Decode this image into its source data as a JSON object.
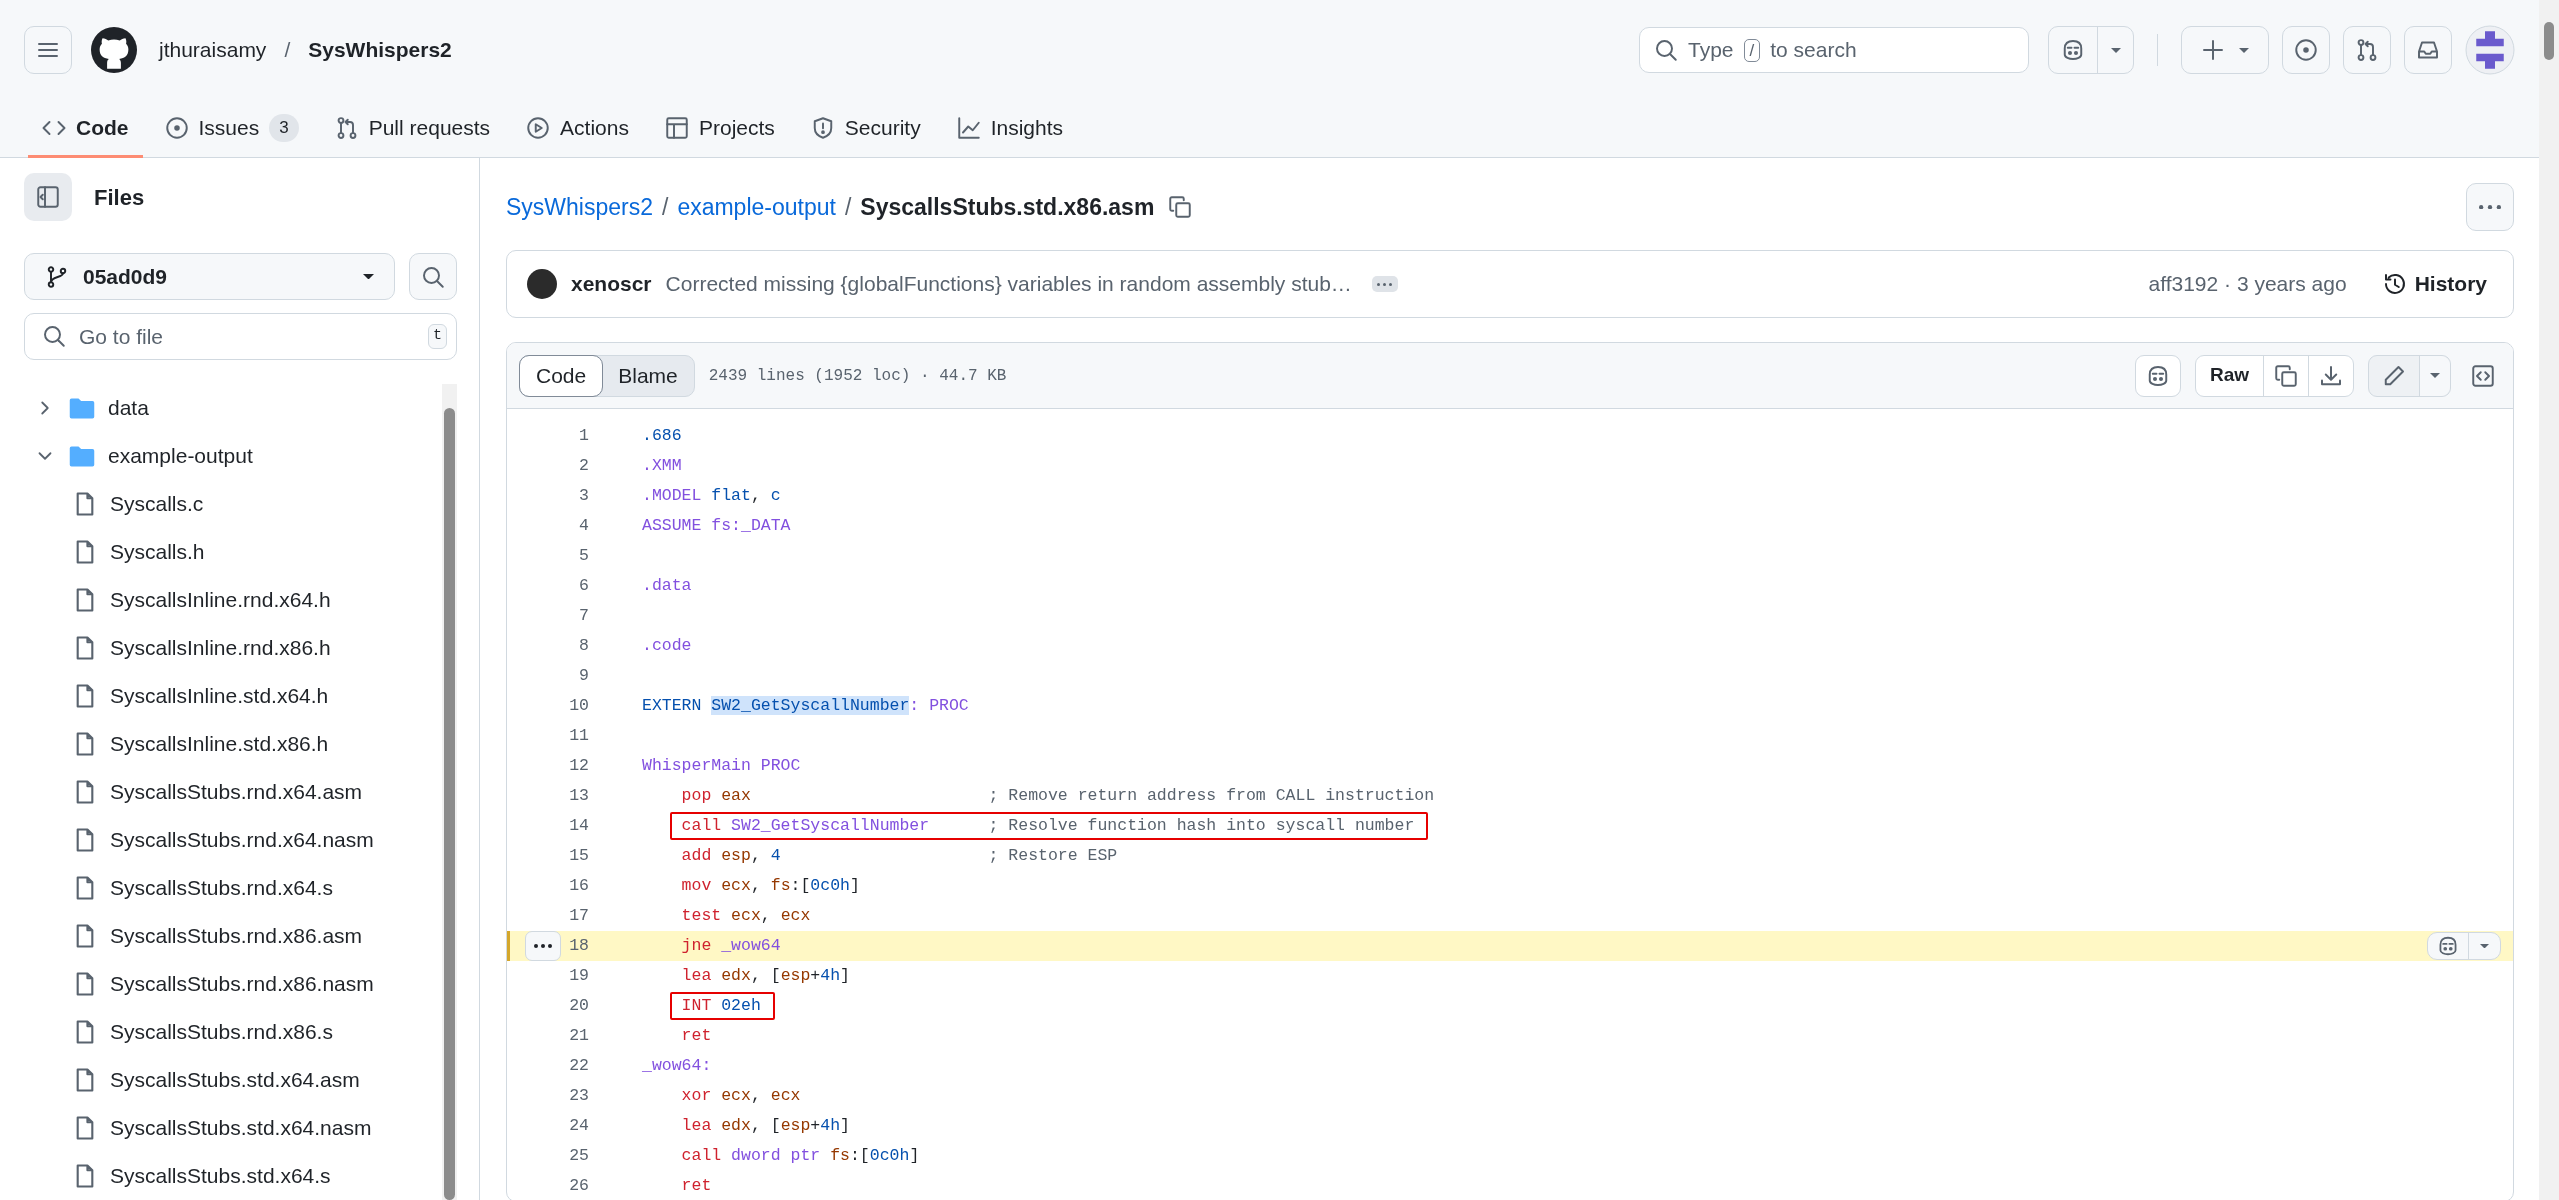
{
  "header": {
    "owner": "jthuraisamy",
    "separator": "/",
    "repo": "SysWhispers2",
    "search": {
      "before": "Type",
      "key": "/",
      "after": "to search"
    }
  },
  "nav_tabs": [
    {
      "label": "Code",
      "selected": true
    },
    {
      "label": "Issues",
      "count": "3",
      "selected": false
    },
    {
      "label": "Pull requests",
      "selected": false
    },
    {
      "label": "Actions",
      "selected": false
    },
    {
      "label": "Projects",
      "selected": false
    },
    {
      "label": "Security",
      "selected": false
    },
    {
      "label": "Insights",
      "selected": false
    }
  ],
  "sidebar": {
    "title": "Files",
    "branch": "05ad0d9",
    "search": {
      "placeholder": "Go to file",
      "shortcut": "t"
    },
    "tree": [
      {
        "kind": "folder",
        "label": "data",
        "expanded": false
      },
      {
        "kind": "folder",
        "label": "example-output",
        "expanded": true,
        "children": [
          {
            "kind": "file",
            "label": "Syscalls.c"
          },
          {
            "kind": "file",
            "label": "Syscalls.h"
          },
          {
            "kind": "file",
            "label": "SyscallsInline.rnd.x64.h"
          },
          {
            "kind": "file",
            "label": "SyscallsInline.rnd.x86.h"
          },
          {
            "kind": "file",
            "label": "SyscallsInline.std.x64.h"
          },
          {
            "kind": "file",
            "label": "SyscallsInline.std.x86.h"
          },
          {
            "kind": "file",
            "label": "SyscallsStubs.rnd.x64.asm"
          },
          {
            "kind": "file",
            "label": "SyscallsStubs.rnd.x64.nasm"
          },
          {
            "kind": "file",
            "label": "SyscallsStubs.rnd.x64.s"
          },
          {
            "kind": "file",
            "label": "SyscallsStubs.rnd.x86.asm"
          },
          {
            "kind": "file",
            "label": "SyscallsStubs.rnd.x86.nasm"
          },
          {
            "kind": "file",
            "label": "SyscallsStubs.rnd.x86.s"
          },
          {
            "kind": "file",
            "label": "SyscallsStubs.std.x64.asm"
          },
          {
            "kind": "file",
            "label": "SyscallsStubs.std.x64.nasm"
          },
          {
            "kind": "file",
            "label": "SyscallsStubs.std.x64.s"
          }
        ]
      }
    ]
  },
  "breadcrumb": [
    {
      "label": "SysWhispers2",
      "link": true
    },
    {
      "separator": "/",
      "label": "example-output",
      "link": true
    },
    {
      "separator": "/",
      "label": "SyscallsStubs.std.x86.asm",
      "link": false
    }
  ],
  "commit": {
    "author": "xenoscr",
    "message": "Corrected missing {globalFunctions} variables in random assembly stub…",
    "meta": "aff3192 · 3 years ago",
    "history": "History"
  },
  "file_toolbar": {
    "views": [
      {
        "label": "Code",
        "selected": true
      },
      {
        "label": "Blame",
        "selected": false
      }
    ],
    "info": "2439 lines (1952 loc) · 44.7 KB",
    "raw": "Raw"
  },
  "code": {
    "lines": [
      {
        "number": "1",
        "highlighted": false,
        "tokens": [
          {
            "kind": "c",
            "text": ".686"
          }
        ]
      },
      {
        "number": "2",
        "highlighted": false,
        "tokens": [
          {
            "kind": "k",
            "text": ".XMM"
          }
        ]
      },
      {
        "number": "3",
        "highlighted": false,
        "tokens": [
          {
            "kind": "k",
            "text": ".MODEL "
          },
          {
            "kind": "c",
            "text": "flat"
          },
          {
            "kind": "p",
            "text": ", "
          },
          {
            "kind": "c",
            "text": "c"
          }
        ]
      },
      {
        "number": "4",
        "highlighted": false,
        "tokens": [
          {
            "kind": "k",
            "text": "ASSUME fs:_DATA"
          }
        ]
      },
      {
        "number": "5",
        "highlighted": false
      },
      {
        "number": "6",
        "highlighted": false,
        "tokens": [
          {
            "kind": "k",
            "text": ".data"
          }
        ]
      },
      {
        "number": "7",
        "highlighted": false
      },
      {
        "number": "8",
        "highlighted": false,
        "tokens": [
          {
            "kind": "k",
            "text": ".code"
          }
        ]
      },
      {
        "number": "9",
        "highlighted": false
      },
      {
        "number": "10",
        "highlighted": false,
        "tokens": [
          {
            "kind": "c",
            "text": "EXTERN ",
            "selected": false
          },
          {
            "kind": "c",
            "text": "SW2_GetSyscallNumber",
            "selected": true
          },
          {
            "kind": "k",
            "text": ": PROC",
            "selected": false
          }
        ]
      },
      {
        "number": "11",
        "highlighted": false
      },
      {
        "number": "12",
        "highlighted": false,
        "tokens": [
          {
            "kind": "k",
            "text": "WhisperMain PROC"
          }
        ]
      },
      {
        "number": "13",
        "highlighted": false,
        "indented": true,
        "tokens": [
          {
            "kind": "i",
            "text": "pop "
          },
          {
            "kind": "r",
            "text": "eax"
          }
        ],
        "comment": "; Remove return address from CALL instruction"
      },
      {
        "number": "14",
        "highlighted": false,
        "indented": true,
        "boxed": true,
        "tokens": [
          {
            "kind": "i",
            "text": "call "
          },
          {
            "kind": "k",
            "text": "SW2_GetSyscallNumber"
          }
        ],
        "comment": "; Resolve function hash into syscall number"
      },
      {
        "number": "15",
        "highlighted": false,
        "indented": true,
        "tokens": [
          {
            "kind": "i",
            "text": "add "
          },
          {
            "kind": "r",
            "text": "esp"
          },
          {
            "kind": "p",
            "text": ", "
          },
          {
            "kind": "c",
            "text": "4"
          }
        ],
        "comment": "; Restore ESP"
      },
      {
        "number": "16",
        "highlighted": false,
        "indented": true,
        "tokens": [
          {
            "kind": "i",
            "text": "mov "
          },
          {
            "kind": "r",
            "text": "ecx"
          },
          {
            "kind": "p",
            "text": ", "
          },
          {
            "kind": "r",
            "text": "fs"
          },
          {
            "kind": "p",
            "text": ":["
          },
          {
            "kind": "c",
            "text": "0c0h"
          },
          {
            "kind": "p",
            "text": "]"
          }
        ]
      },
      {
        "number": "17",
        "highlighted": false,
        "indented": true,
        "tokens": [
          {
            "kind": "i",
            "text": "test "
          },
          {
            "kind": "r",
            "text": "ecx"
          },
          {
            "kind": "p",
            "text": ", "
          },
          {
            "kind": "r",
            "text": "ecx"
          }
        ]
      },
      {
        "number": "18",
        "highlighted": true,
        "indented": true,
        "tokens": [
          {
            "kind": "i",
            "text": "jne "
          },
          {
            "kind": "k",
            "text": "_wow64"
          }
        ]
      },
      {
        "number": "19",
        "highlighted": false,
        "indented": true,
        "tokens": [
          {
            "kind": "i",
            "text": "lea "
          },
          {
            "kind": "r",
            "text": "edx"
          },
          {
            "kind": "p",
            "text": ", ["
          },
          {
            "kind": "r",
            "text": "esp"
          },
          {
            "kind": "p",
            "text": "+"
          },
          {
            "kind": "c",
            "text": "4h"
          },
          {
            "kind": "p",
            "text": "]"
          }
        ]
      },
      {
        "number": "20",
        "highlighted": false,
        "indented": true,
        "boxed": true,
        "tokens": [
          {
            "kind": "i",
            "text": "INT "
          },
          {
            "kind": "c",
            "text": "02eh"
          }
        ]
      },
      {
        "number": "21",
        "highlighted": false,
        "indented": true,
        "tokens": [
          {
            "kind": "i",
            "text": "ret"
          }
        ]
      },
      {
        "number": "22",
        "highlighted": false,
        "tokens": [
          {
            "kind": "k",
            "text": "_wow64:"
          }
        ]
      },
      {
        "number": "23",
        "highlighted": false,
        "indented": true,
        "tokens": [
          {
            "kind": "i",
            "text": "xor "
          },
          {
            "kind": "r",
            "text": "ecx"
          },
          {
            "kind": "p",
            "text": ", "
          },
          {
            "kind": "r",
            "text": "ecx"
          }
        ]
      },
      {
        "number": "24",
        "highlighted": false,
        "indented": true,
        "tokens": [
          {
            "kind": "i",
            "text": "lea "
          },
          {
            "kind": "r",
            "text": "edx"
          },
          {
            "kind": "p",
            "text": ", ["
          },
          {
            "kind": "r",
            "text": "esp"
          },
          {
            "kind": "p",
            "text": "+"
          },
          {
            "kind": "c",
            "text": "4h"
          },
          {
            "kind": "p",
            "text": "]"
          }
        ]
      },
      {
        "number": "25",
        "highlighted": false,
        "indented": true,
        "tokens": [
          {
            "kind": "i",
            "text": "call "
          },
          {
            "kind": "k",
            "text": "dword ptr "
          },
          {
            "kind": "r",
            "text": "fs"
          },
          {
            "kind": "p",
            "text": ":["
          },
          {
            "kind": "c",
            "text": "0c0h"
          },
          {
            "kind": "p",
            "text": "]"
          }
        ]
      },
      {
        "number": "26",
        "highlighted": false,
        "indented": true,
        "tokens": [
          {
            "kind": "i",
            "text": "ret"
          }
        ]
      }
    ]
  }
}
